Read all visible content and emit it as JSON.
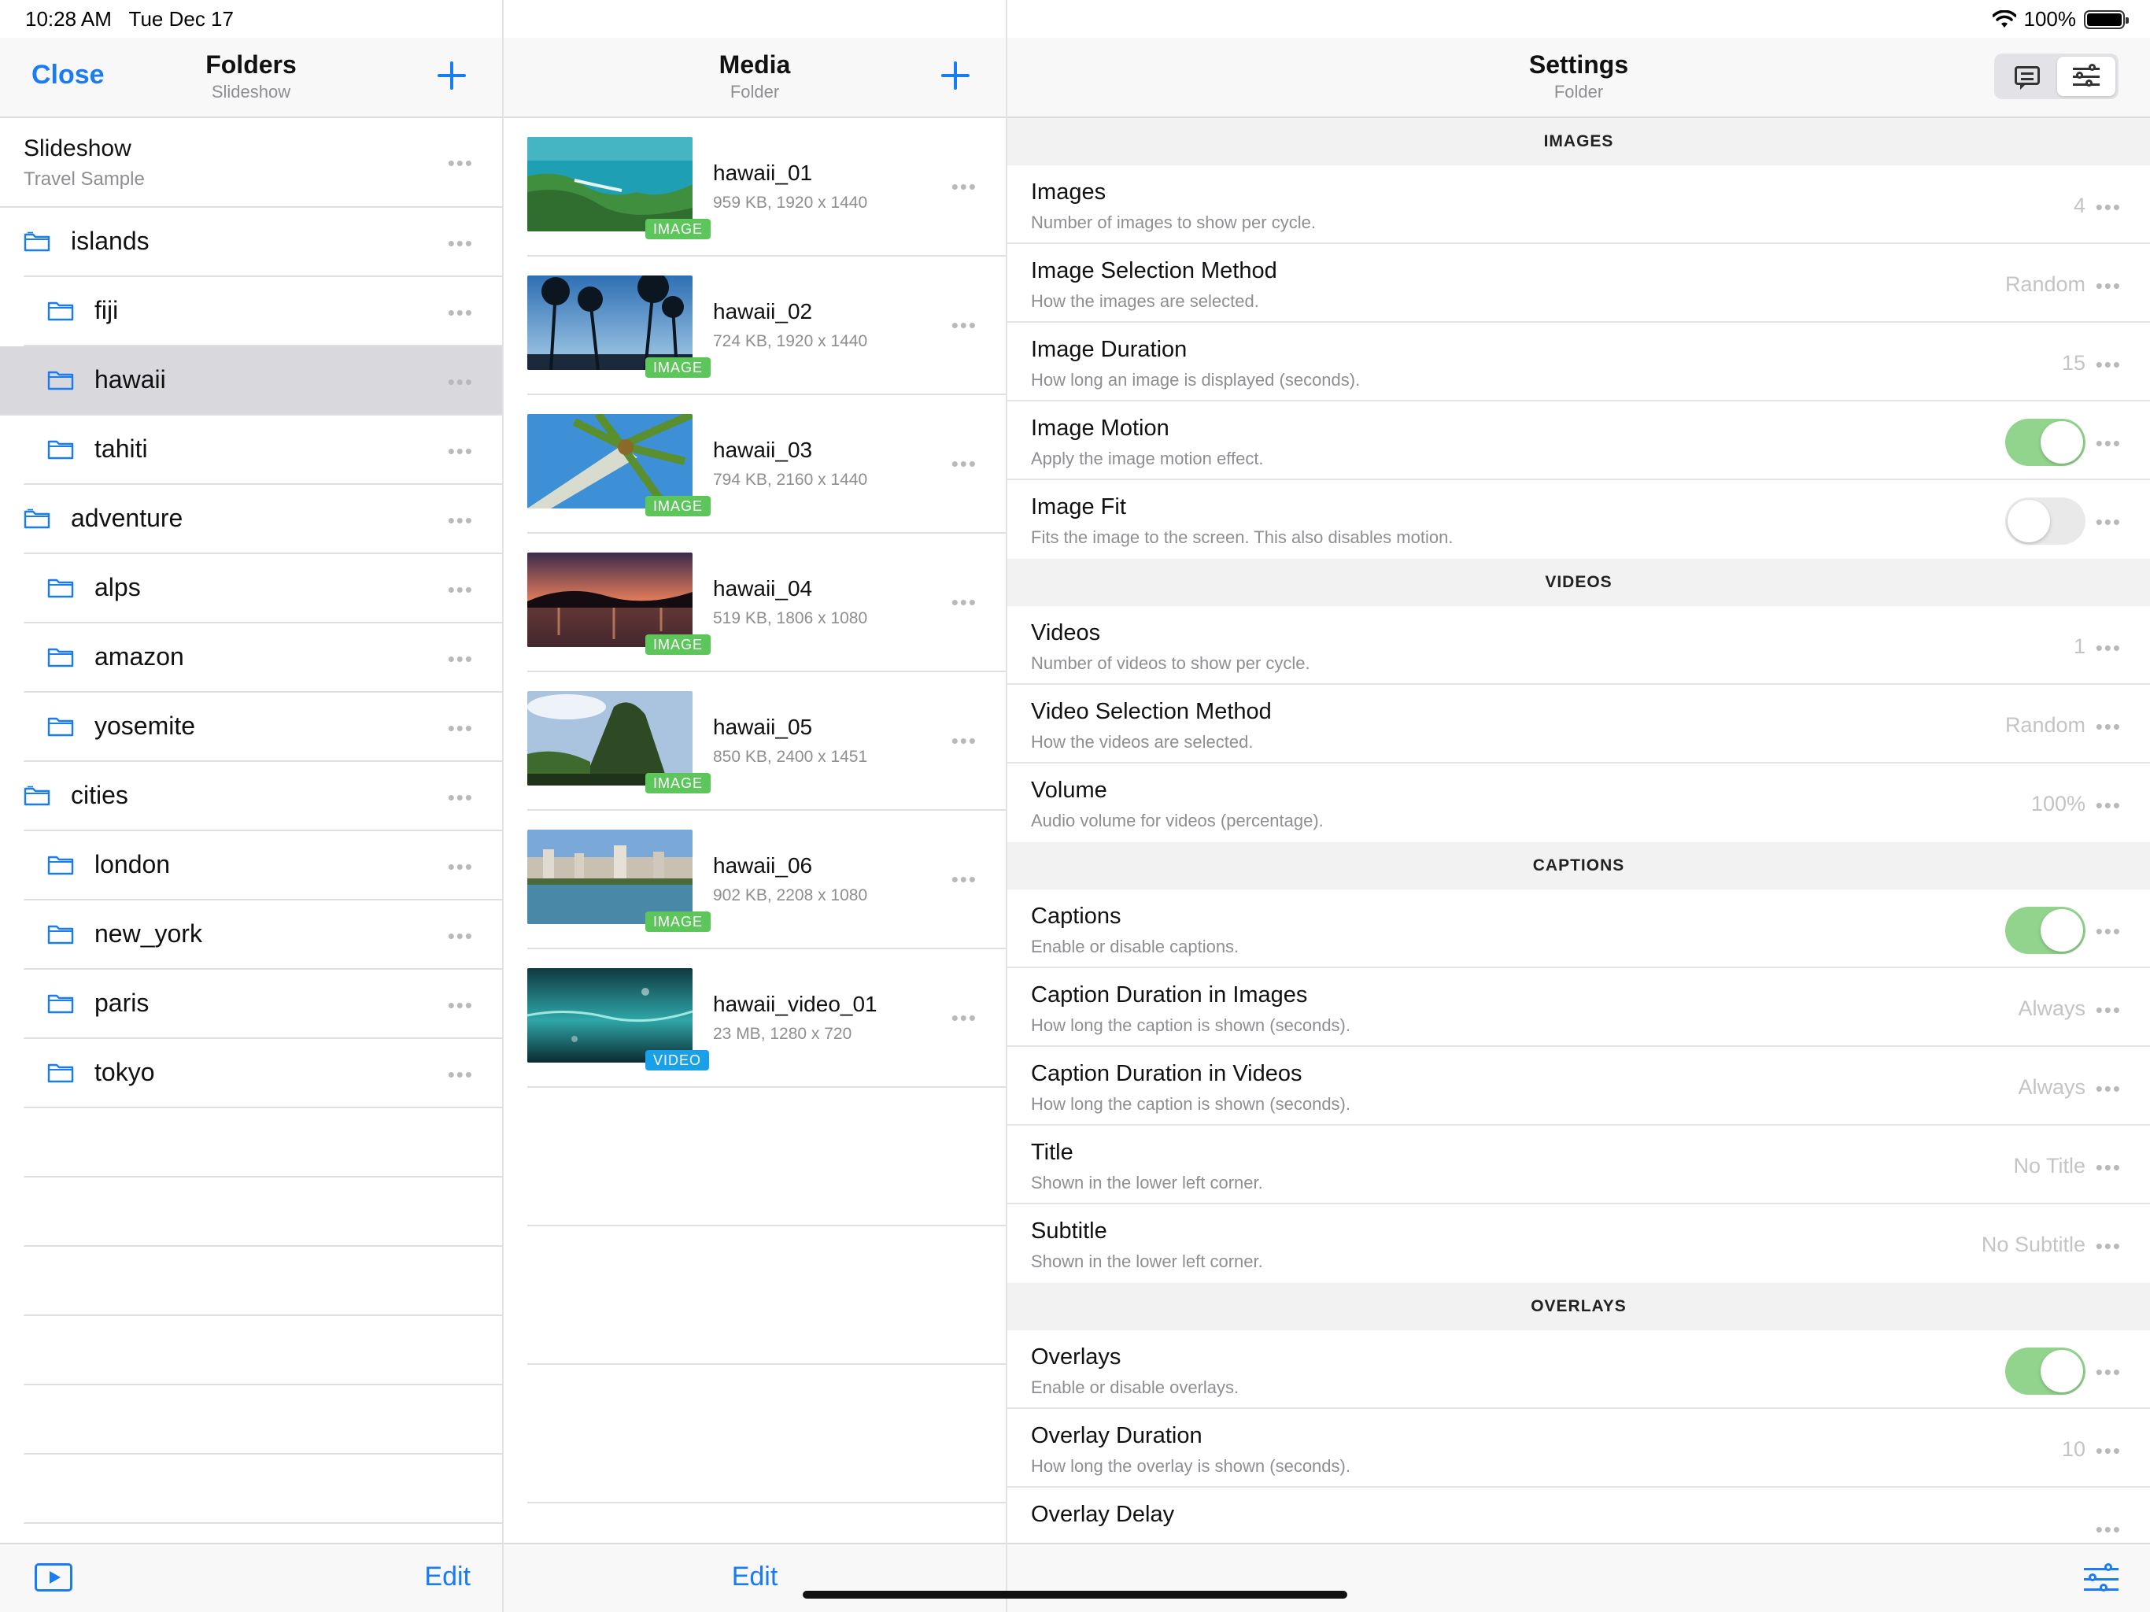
{
  "status": {
    "time": "10:28 AM",
    "date": "Tue Dec 17",
    "battery": "100%"
  },
  "folders": {
    "nav": {
      "close": "Close",
      "title": "Folders",
      "subtitle": "Slideshow"
    },
    "root": {
      "title": "Slideshow",
      "subtitle": "Travel Sample"
    },
    "items": [
      {
        "name": "islands",
        "level": 0
      },
      {
        "name": "fiji",
        "level": 1
      },
      {
        "name": "hawaii",
        "level": 1,
        "selected": true
      },
      {
        "name": "tahiti",
        "level": 1
      },
      {
        "name": "adventure",
        "level": 0
      },
      {
        "name": "alps",
        "level": 1
      },
      {
        "name": "amazon",
        "level": 1
      },
      {
        "name": "yosemite",
        "level": 1
      },
      {
        "name": "cities",
        "level": 0
      },
      {
        "name": "london",
        "level": 1
      },
      {
        "name": "new_york",
        "level": 1
      },
      {
        "name": "paris",
        "level": 1
      },
      {
        "name": "tokyo",
        "level": 1
      }
    ],
    "toolbar": {
      "edit": "Edit"
    }
  },
  "media": {
    "nav": {
      "title": "Media",
      "subtitle": "Folder"
    },
    "items": [
      {
        "name": "hawaii_01",
        "meta": "959 KB, 1920 x 1440",
        "badge": "IMAGE",
        "thumb": "aerial-coast"
      },
      {
        "name": "hawaii_02",
        "meta": "724 KB, 1920 x 1440",
        "badge": "IMAGE",
        "thumb": "palm-silhouettes"
      },
      {
        "name": "hawaii_03",
        "meta": "794 KB, 2160 x 1440",
        "badge": "IMAGE",
        "thumb": "palm-tree-sky"
      },
      {
        "name": "hawaii_04",
        "meta": "519 KB, 1806 x 1080",
        "badge": "IMAGE",
        "thumb": "sunset-palms"
      },
      {
        "name": "hawaii_05",
        "meta": "850 KB, 2400 x 1451",
        "badge": "IMAGE",
        "thumb": "green-mountain"
      },
      {
        "name": "hawaii_06",
        "meta": "902 KB, 2208 x 1080",
        "badge": "IMAGE",
        "thumb": "city-beach"
      },
      {
        "name": "hawaii_video_01",
        "meta": "23 MB, 1280 x 720",
        "badge": "VIDEO",
        "thumb": "underwater"
      }
    ],
    "toolbar": {
      "edit": "Edit"
    }
  },
  "settings": {
    "nav": {
      "title": "Settings",
      "subtitle": "Folder"
    },
    "sections": [
      {
        "header": "IMAGES",
        "rows": [
          {
            "title": "Images",
            "desc": "Number of images to show per cycle.",
            "value": "4"
          },
          {
            "title": "Image Selection Method",
            "desc": "How the images are selected.",
            "value": "Random"
          },
          {
            "title": "Image Duration",
            "desc": "How long an image is displayed (seconds).",
            "value": "15"
          },
          {
            "title": "Image Motion",
            "desc": "Apply the image motion effect.",
            "toggle": true
          },
          {
            "title": "Image Fit",
            "desc": "Fits the image to the screen. This also disables motion.",
            "toggle": false
          }
        ]
      },
      {
        "header": "VIDEOS",
        "rows": [
          {
            "title": "Videos",
            "desc": "Number of videos to show per cycle.",
            "value": "1"
          },
          {
            "title": "Video Selection Method",
            "desc": "How the videos are selected.",
            "value": "Random"
          },
          {
            "title": "Volume",
            "desc": "Audio volume for videos (percentage).",
            "value": "100%"
          }
        ]
      },
      {
        "header": "CAPTIONS",
        "rows": [
          {
            "title": "Captions",
            "desc": "Enable or disable captions.",
            "toggle": true
          },
          {
            "title": "Caption Duration in Images",
            "desc": "How long the caption is shown (seconds).",
            "value": "Always"
          },
          {
            "title": "Caption Duration in Videos",
            "desc": "How long the caption is shown (seconds).",
            "value": "Always"
          },
          {
            "title": "Title",
            "desc": "Shown in the lower left corner.",
            "value": "No Title"
          },
          {
            "title": "Subtitle",
            "desc": "Shown in the lower left corner.",
            "value": "No Subtitle"
          }
        ]
      },
      {
        "header": "OVERLAYS",
        "rows": [
          {
            "title": "Overlays",
            "desc": "Enable or disable overlays.",
            "toggle": true
          },
          {
            "title": "Overlay Duration",
            "desc": "How long the overlay is shown (seconds).",
            "value": "10"
          },
          {
            "title": "Overlay Delay",
            "desc": "",
            "value": ""
          }
        ]
      }
    ]
  },
  "colors": {
    "accent": "#1a7cf5",
    "toggle_on": "#92d48d",
    "image_badge": "#5cc65a",
    "video_badge": "#1aa0e8",
    "selected_row": "#d8d8dd"
  }
}
